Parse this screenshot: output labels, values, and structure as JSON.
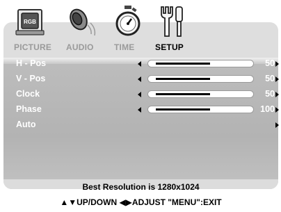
{
  "tabs": [
    {
      "label": "PICTURE",
      "icon": "picture-icon",
      "icon_text": "RGB",
      "active": false
    },
    {
      "label": "AUDIO",
      "icon": "speaker-icon",
      "active": false
    },
    {
      "label": "TIME",
      "icon": "stopwatch-icon",
      "active": false
    },
    {
      "label": "SETUP",
      "icon": "tools-icon",
      "active": true
    }
  ],
  "rows": [
    {
      "label": "H - Pos",
      "value": "50",
      "level": 0.5
    },
    {
      "label": "V - Pos",
      "value": "50",
      "level": 0.5
    },
    {
      "label": "Clock",
      "value": "50",
      "level": 0.5
    },
    {
      "label": "Phase",
      "value": "100",
      "level": 0.5
    },
    {
      "label": "Auto"
    }
  ],
  "footer": {
    "resolution_text": "Best Resolution is 1280x1024",
    "hint_text": "▲▼UP/DOWN  ◀▶ADJUST  \"MENU\":EXIT"
  }
}
